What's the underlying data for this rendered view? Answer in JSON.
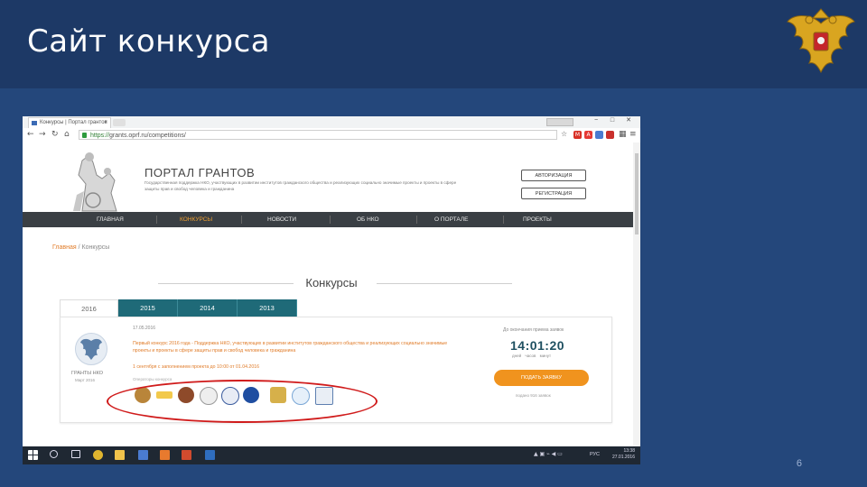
{
  "slide": {
    "title": "Сайт конкурса",
    "page_number": "6"
  },
  "browser": {
    "tab_title": "Конкурсы | Портал грантов",
    "url_secure": "https://",
    "url_rest": "grants.oprf.ru/competitions/",
    "window_controls": [
      "−",
      "□",
      "✕"
    ]
  },
  "site": {
    "portal_title": "ПОРТАЛ ГРАНТОВ",
    "portal_subtitle": "Государственная поддержка НКО, участвующих в развитии институтов гражданского общества и реализующих социально значимые проекты и проекты в сфере защиты прав и свобод человека и гражданина",
    "login_button": "АВТОРИЗАЦИЯ",
    "register_button": "РЕГИСТРАЦИЯ",
    "nav": [
      "ГЛАВНАЯ",
      "КОНКУРСЫ",
      "НОВОСТИ",
      "ОБ НКО",
      "О ПОРТАЛЕ",
      "ПРОЕКТЫ"
    ],
    "nav_active": "КОНКУРСЫ",
    "breadcrumb_home": "Главная",
    "breadcrumb_sep": "/",
    "breadcrumb_current": "Конкурсы",
    "section_title": "Конкурсы",
    "year_tabs": [
      "2016",
      "2015",
      "2014",
      "2013"
    ],
    "year_active": "2016",
    "competition": {
      "date": "17.05.2016",
      "description": "Первый конкурс 2016 года - Поддержка НКО, участвующих в развитии институтов гражданского общества и реализующих социально значимые проекты и проекты в сфере защиты прав и свобод человека и гражданина",
      "period": "1 сентября с заполнением проекта до 10:00 от 01.04.2016",
      "operators_label": "Операторы конкурса",
      "grants_label": "ГРАНТЫ НКО",
      "grants_date": "Март 2016",
      "deadline_label": "До окончания приема заявок",
      "timer": "14:01:20",
      "timer_units": "дней часов минут",
      "apply_button": "ПОДАТЬ ЗАЯВКУ",
      "applications_count": "подано 916 заявок",
      "partner_count": 9
    }
  },
  "taskbar": {
    "lang": "РУС",
    "time": "13:38",
    "date": "27.01.2016"
  },
  "colors": {
    "slide_bg": "#24477b",
    "header_bg": "#1d3966",
    "nav_bg": "#3a3f44",
    "tab_teal": "#1f6a78",
    "accent_orange": "#f0931e",
    "highlight_red": "#d01b1b"
  }
}
